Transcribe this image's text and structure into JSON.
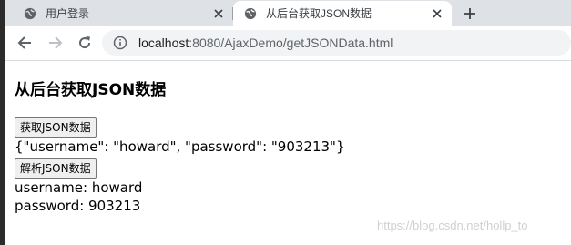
{
  "browser": {
    "tabs": [
      {
        "label": "用户登录",
        "active": false
      },
      {
        "label": "从后台获取JSON数据",
        "active": true
      }
    ],
    "url": {
      "host": "localhost",
      "rest": ":8080/AjaxDemo/getJSONData.html"
    },
    "icons": {
      "back": "arrow-left-icon",
      "forward": "arrow-right-icon",
      "reload": "reload-icon",
      "info": "info-icon",
      "new_tab": "plus-icon",
      "close": "close-icon",
      "favicon": "globe-icon"
    }
  },
  "page": {
    "title": "从后台获取JSON数据",
    "get_button": "获取JSON数据",
    "json_text": "{\"username\": \"howard\", \"password\": \"903213\"}",
    "parse_button": "解析JSON数据",
    "username_line": "username: howard",
    "password_line": "password: 903213"
  },
  "watermark": "https://blog.csdn.net/hollp_to"
}
